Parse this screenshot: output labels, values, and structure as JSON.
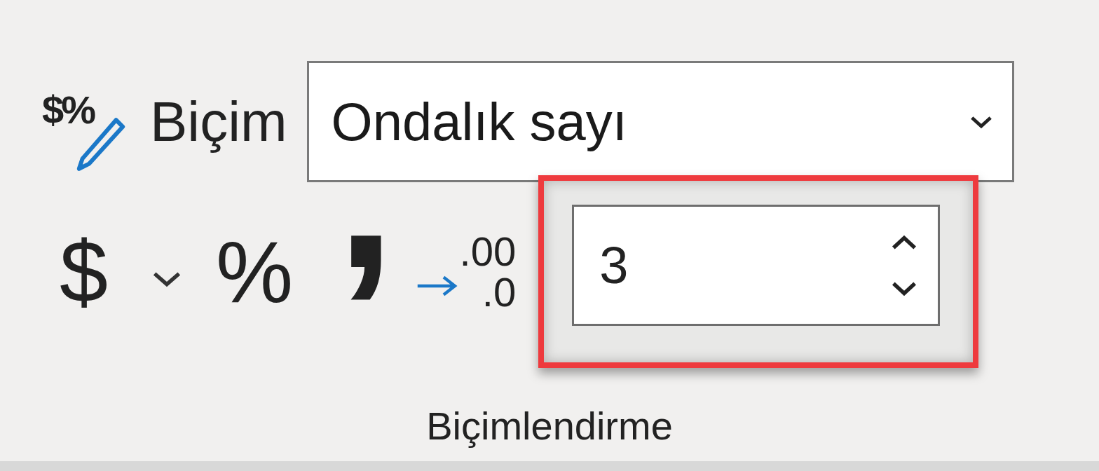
{
  "format_row": {
    "icon_text": "$%",
    "label": "Biçim",
    "dropdown": {
      "value": "Ondalık sayı"
    }
  },
  "tool_buttons": [
    {
      "kind": "glyph",
      "text": "$"
    },
    {
      "kind": "caret"
    },
    {
      "kind": "glyph",
      "text": "%"
    },
    {
      "kind": "comma",
      "text": ","
    },
    {
      "kind": "decimal",
      "top": ".00",
      "bottom": ".0"
    }
  ],
  "decimal_places": {
    "value": "3",
    "highlighted": true
  },
  "group_label": "Biçimlendirme"
}
